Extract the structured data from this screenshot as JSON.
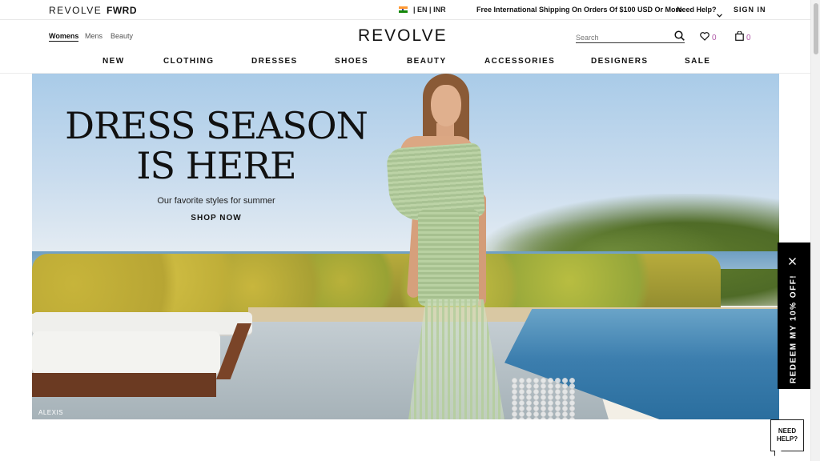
{
  "topbar": {
    "brand_revolve": "REVOLVE",
    "brand_fwrd": "FWRD",
    "flag_icon": "india-flag-icon",
    "language": "EN",
    "currency": "INR",
    "shipping": "Free International Shipping On Orders Of $100 USD Or More",
    "help": "Need Help?",
    "signin": "SIGN IN"
  },
  "header": {
    "genders": [
      "Womens",
      "Mens",
      "Beauty"
    ],
    "logo": "REVOLVE",
    "search_placeholder": "Search",
    "wishlist_count": "0",
    "bag_count": "0"
  },
  "nav": {
    "items": [
      "NEW",
      "CLOTHING",
      "DRESSES",
      "SHOES",
      "BEAUTY",
      "ACCESSORIES",
      "DESIGNERS",
      "SALE"
    ]
  },
  "hero": {
    "title_line1": "DRESS SEASON",
    "title_line2": "IS HERE",
    "subtitle": "Our favorite styles for summer",
    "cta": "SHOP NOW",
    "credit": "ALEXIS"
  },
  "promo": {
    "text": "REDEEM MY 10% OFF!"
  },
  "chat": {
    "line1": "NEED",
    "line2": "HELP?"
  },
  "colors": {
    "count_accent": "#b05aa8",
    "promo_bg": "#000000",
    "text": "#111111"
  }
}
